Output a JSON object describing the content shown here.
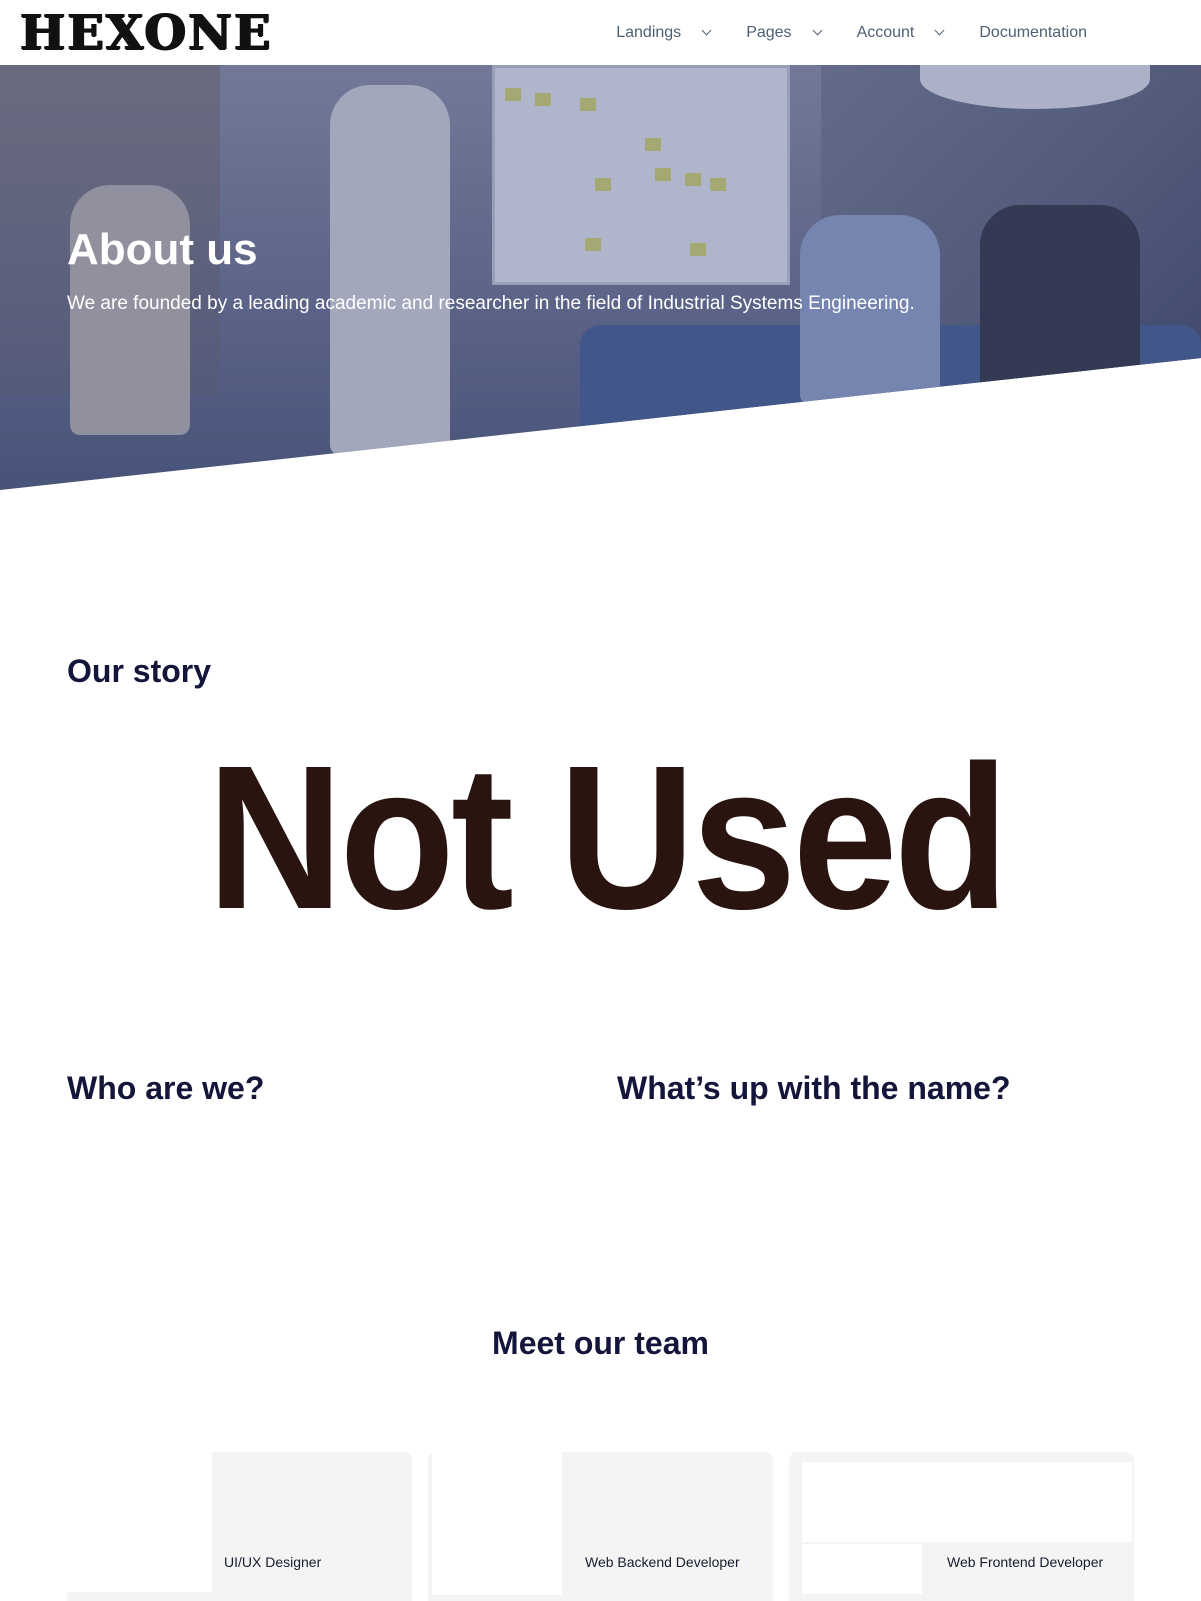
{
  "header": {
    "logo": "HEXONE",
    "nav": [
      {
        "label": "Landings",
        "has_dropdown": true
      },
      {
        "label": "Pages",
        "has_dropdown": true
      },
      {
        "label": "Account",
        "has_dropdown": true
      },
      {
        "label": "Documentation",
        "has_dropdown": false
      }
    ]
  },
  "hero": {
    "title": "About us",
    "subtitle": "We are founded by a leading academic and researcher in the field of Industrial Systems Engineering."
  },
  "story": {
    "title": "Our story",
    "image_text": "Not Used",
    "who_title": "Who are we?",
    "name_title": "What’s up with the name?"
  },
  "team": {
    "title": "Meet our team",
    "members": [
      {
        "role": "UI/UX Designer"
      },
      {
        "role": "Web Backend Developer"
      },
      {
        "role": "Web Frontend Developer"
      }
    ]
  }
}
